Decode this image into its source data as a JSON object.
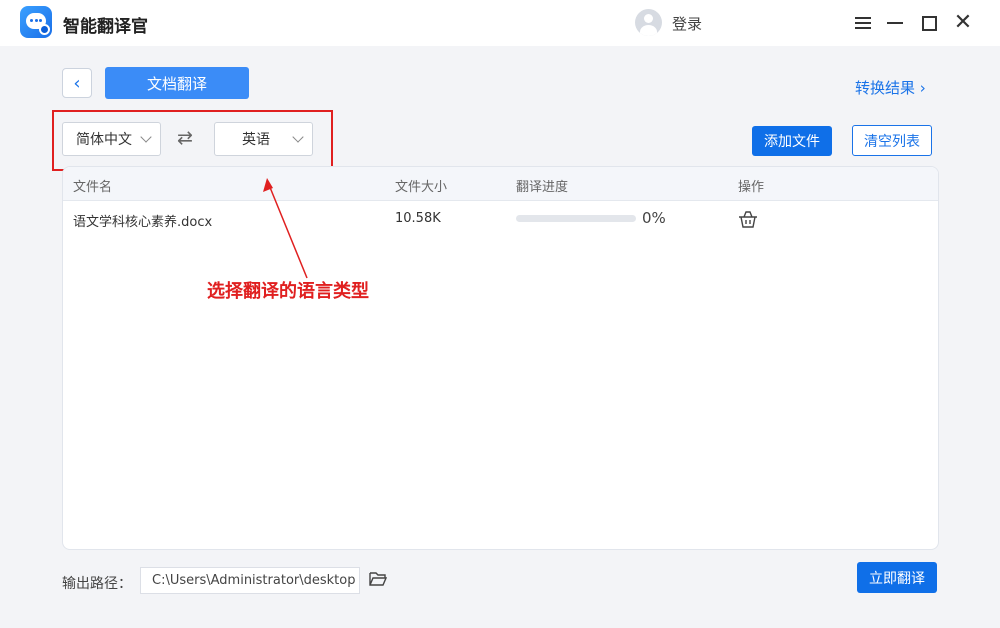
{
  "app": {
    "title": "智能翻译官",
    "login_label": "登录",
    "logo_icon": "chat-bubble-logo-icon"
  },
  "toolbar": {
    "back_icon": "chevron-left-icon",
    "mode_label": "文档翻译",
    "result_link": "转换结果 ›"
  },
  "languages": {
    "source": "简体中文",
    "target": "英语",
    "swap_icon": "⇄"
  },
  "actions": {
    "add_files": "添加文件",
    "clear_list": "清空列表",
    "start_translate": "立即翻译"
  },
  "table": {
    "headers": {
      "name": "文件名",
      "size": "文件大小",
      "progress": "翻译进度",
      "action": "操作"
    },
    "rows": [
      {
        "name": "语文学科核心素养.docx",
        "size": "10.58K",
        "progress_value": 0,
        "progress_text": "0%",
        "action_icon": "trash-basket-icon"
      }
    ]
  },
  "annotation": {
    "text": "选择翻译的语言类型",
    "color": "#e02020"
  },
  "output": {
    "label": "输出路径：",
    "path": "C:\\Users\\Administrator\\desktop",
    "folder_icon": "folder-open-icon"
  },
  "colors": {
    "accent": "#0f6fe8",
    "accent_light": "#3b8cf7",
    "annotation": "#e02020"
  }
}
